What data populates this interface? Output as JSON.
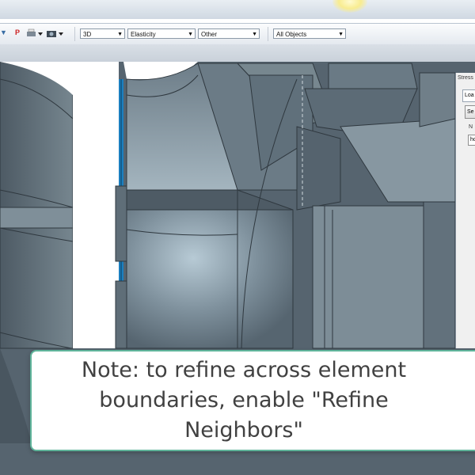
{
  "toolbar": {
    "items": [
      {
        "label": "▼",
        "icon": "arrow-dropdown-icon"
      },
      {
        "label": "P",
        "icon": "p-icon",
        "color": "#cc2222"
      },
      {
        "label": "▼",
        "icon": "print-icon"
      },
      {
        "label": "▼",
        "icon": "camera-icon"
      }
    ],
    "combos": {
      "analysis_type": "3D",
      "result_type": "Elasticity",
      "other": "Other",
      "objects": "All Objects"
    }
  },
  "side_panel": {
    "title": "Stress",
    "tab": "Loa",
    "button": "Se",
    "label": "N",
    "field": "ho"
  },
  "caption": {
    "text": "Note: to refine across element boundaries, enable \"Refine Neighbors\""
  },
  "colors": {
    "mesh_face": "#56646f",
    "mesh_light": "#a7bcc8",
    "edge_highlight": "#1b7fbf",
    "note_border": "#5fb49a",
    "toolbar_bg": "#e9eef3"
  }
}
